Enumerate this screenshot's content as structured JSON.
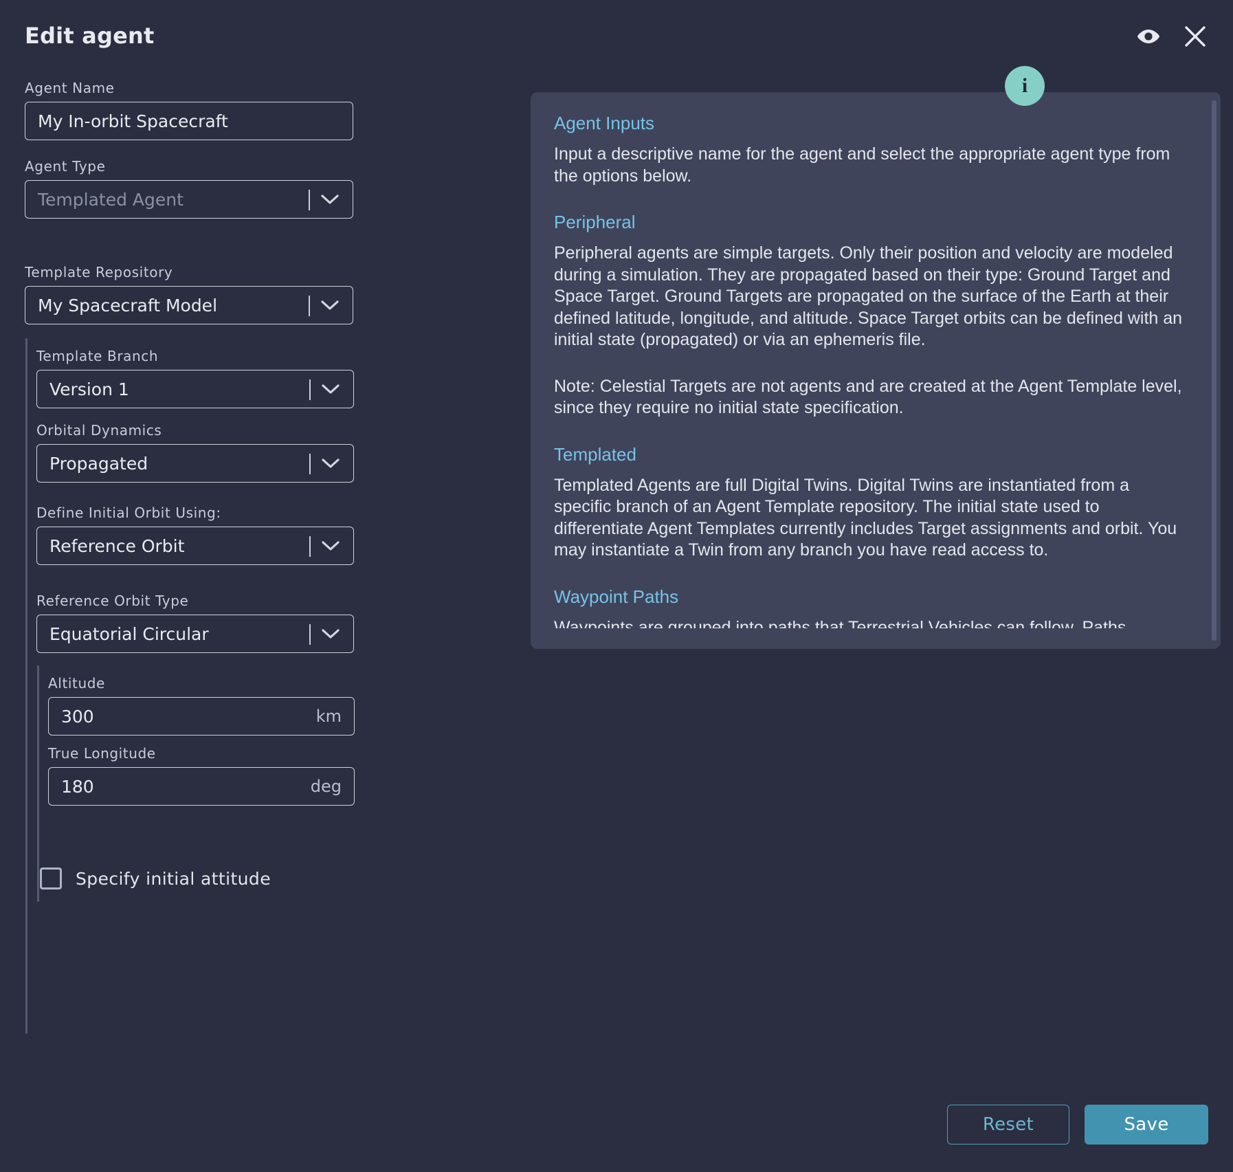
{
  "dialog": {
    "title": "Edit agent",
    "icons": {
      "preview": "eye-icon",
      "close": "close-icon",
      "info": "info-icon",
      "info_glyph": "i"
    }
  },
  "form": {
    "agent_name": {
      "label": "Agent Name",
      "value": "My In-orbit Spacecraft",
      "placeholder": "Agent Name"
    },
    "agent_type": {
      "label": "Agent Type",
      "value": "Templated Agent",
      "is_placeholder": true
    },
    "template_repository": {
      "label": "Template Repository",
      "value": "My Spacecraft Model"
    },
    "template_branch": {
      "label": "Template Branch",
      "value": "Version 1"
    },
    "orbital_dynamics": {
      "label": "Orbital Dynamics",
      "value": "Propagated"
    },
    "define_initial_orbit": {
      "label": "Define Initial Orbit Using:",
      "value": "Reference Orbit"
    },
    "reference_orbit_type": {
      "label": "Reference Orbit Type",
      "value": "Equatorial Circular"
    },
    "altitude": {
      "label": "Altitude",
      "value": "300",
      "unit": "km"
    },
    "true_longitude": {
      "label": "True Longitude",
      "value": "180",
      "unit": "deg"
    },
    "specify_initial_attitude": {
      "label": "Specify initial attitude",
      "checked": false
    }
  },
  "info_panel": {
    "sections": [
      {
        "heading": "Agent Inputs",
        "body": "Input a descriptive name for the agent and select the appropriate agent type from the options below."
      },
      {
        "heading": "Peripheral",
        "body": "Peripheral agents are simple targets. Only their position and velocity are modeled during a simulation. They are propagated based on their type: Ground Target and Space Target. Ground Targets are propagated on the surface of the Earth at their defined latitude, longitude, and altitude. Space Target orbits can be defined with an initial state (propagated) or via an ephemeris file."
      },
      {
        "heading": "",
        "body": "Note: Celestial Targets are not agents and are created at the Agent Template level, since they require no initial state specification."
      },
      {
        "heading": "Templated",
        "body": "Templated Agents are full Digital Twins. Digital Twins are instantiated from a specific branch of an Agent Template repository. The initial state used to differentiate Agent Templates currently includes Target assignments and orbit. You may instantiate a Twin from any branch you have read access to."
      },
      {
        "heading": "Waypoint Paths",
        "body": "Waypoints are grouped into paths that Terrestrial Vehicles can follow. Paths defined with speeds can be composed together as a dynamic waypoint path."
      }
    ]
  },
  "footer": {
    "reset_label": "Reset",
    "save_label": "Save"
  },
  "colors": {
    "background": "#2a2e40",
    "panel": "#40445a",
    "heading_link": "#76c3e8",
    "accent_teal": "#86cfc7",
    "save_blue": "#4193b0",
    "reset_border": "#4f9fb8",
    "field_border": "#cfd3dd",
    "text": "#e3e6ee"
  }
}
